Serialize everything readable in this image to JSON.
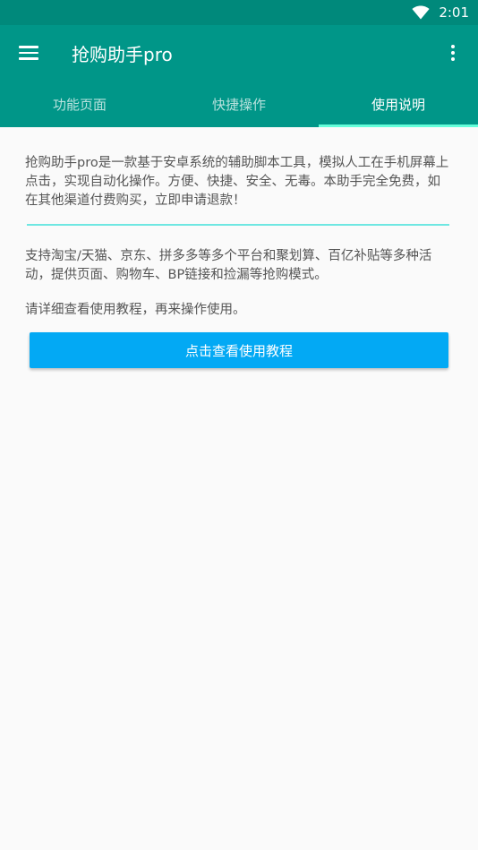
{
  "status_bar": {
    "time": "2:01",
    "wifi_icon": "wifi-icon"
  },
  "app_bar": {
    "title": "抢购助手pro",
    "menu_icon": "menu-icon",
    "overflow_icon": "more-vert-icon"
  },
  "tabs": [
    {
      "label": "功能页面",
      "active": false
    },
    {
      "label": "快捷操作",
      "active": false
    },
    {
      "label": "使用说明",
      "active": true
    }
  ],
  "content": {
    "intro": "抢购助手pro是一款基于安卓系统的辅助脚本工具，模拟人工在手机屏幕上点击，实现自动化操作。方便、快捷、安全、无毒。本助手完全免费，如在其他渠道付费购买，立即申请退款！",
    "features": "支持淘宝/天猫、京东、拼多多等多个平台和聚划算、百亿补贴等多种活动，提供页面、购物车、BP链接和捡漏等抢购模式。",
    "instruction": "请详细查看使用教程，再来操作使用。",
    "tutorial_button": "点击查看使用教程"
  },
  "colors": {
    "status_bar": "#00897b",
    "app_bar": "#009688",
    "tab_indicator": "#64ffda",
    "divider": "#6ee7e2",
    "button": "#03a9f4",
    "background": "#fafafa",
    "body_text": "#555555"
  }
}
